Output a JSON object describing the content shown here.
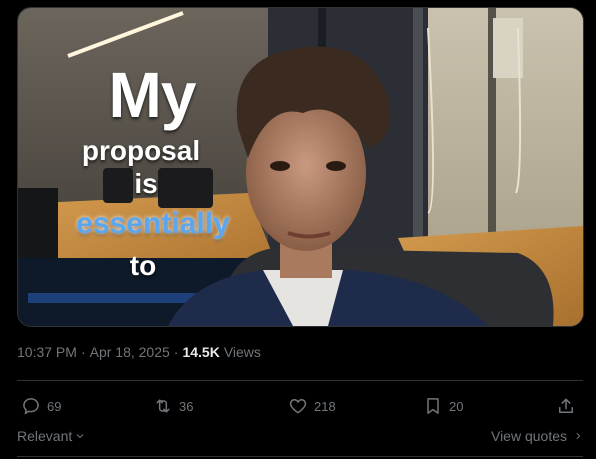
{
  "media": {
    "caption": {
      "line1": "My",
      "line2": "proposal",
      "line3": "is",
      "line4": "essentially",
      "line5": "to"
    }
  },
  "tweet_meta": {
    "time": "10:37 PM",
    "separator": "·",
    "date": "Apr 18, 2025",
    "dot": "·",
    "views_count": "14.5K",
    "views_label": "Views"
  },
  "actions": {
    "replies": "69",
    "reposts": "36",
    "likes": "218",
    "bookmarks": "20"
  },
  "footer": {
    "sort_label": "Relevant",
    "view_quotes_label": "View quotes"
  },
  "colors": {
    "background": "#000000",
    "muted_text": "#71767b",
    "primary_text": "#e7e9ea",
    "divider": "#2f3336",
    "caption_highlight": "#5aa7ef"
  }
}
